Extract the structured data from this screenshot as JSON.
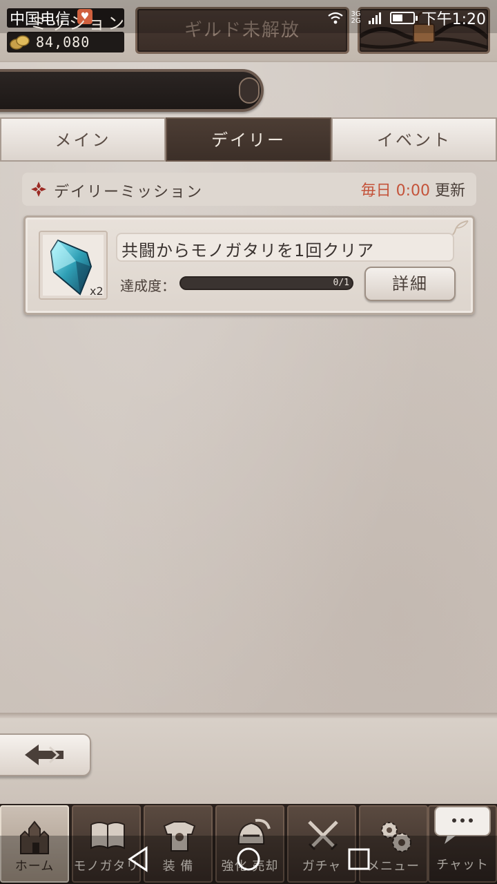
{
  "status_bar": {
    "carrier": "中国电信",
    "network_top": "3G",
    "network_bottom": "2G",
    "time": "下午1:20"
  },
  "player": {
    "coins": "84,080"
  },
  "header": {
    "guild_button": "ギルド未解放",
    "mission_title": "ミッション"
  },
  "tabs": [
    {
      "label": "メイン",
      "active": false
    },
    {
      "label": "デイリー",
      "active": true
    },
    {
      "label": "イベント",
      "active": false
    }
  ],
  "daily": {
    "title": "デイリーミッション",
    "reset_prefix": "毎日",
    "reset_time": "0:00",
    "reset_suffix": "更新"
  },
  "missions": [
    {
      "name": "共闘からモノガタリを1回クリア",
      "progress_label": "達成度：",
      "progress_text": "0/1",
      "progress_fraction": 0,
      "reward_qty": "x2",
      "detail_button": "詳細"
    }
  ],
  "bottom_nav": {
    "items": [
      {
        "label": "ホーム",
        "icon": "castle-icon",
        "active": true
      },
      {
        "label": "モノガタリ",
        "icon": "book-icon",
        "active": false
      },
      {
        "label": "装 備",
        "icon": "armor-icon",
        "active": false
      },
      {
        "label": "強化 売却",
        "icon": "helmet-icon",
        "active": false
      },
      {
        "label": "ガチャ",
        "icon": "swords-icon",
        "active": false
      },
      {
        "label": "メニュー",
        "icon": "gears-icon",
        "active": false
      }
    ],
    "chat_label": "チャット"
  },
  "colors": {
    "accent_red": "#c4533a",
    "tab_active": "#3c2f28",
    "paper": "#cdc4bc"
  }
}
